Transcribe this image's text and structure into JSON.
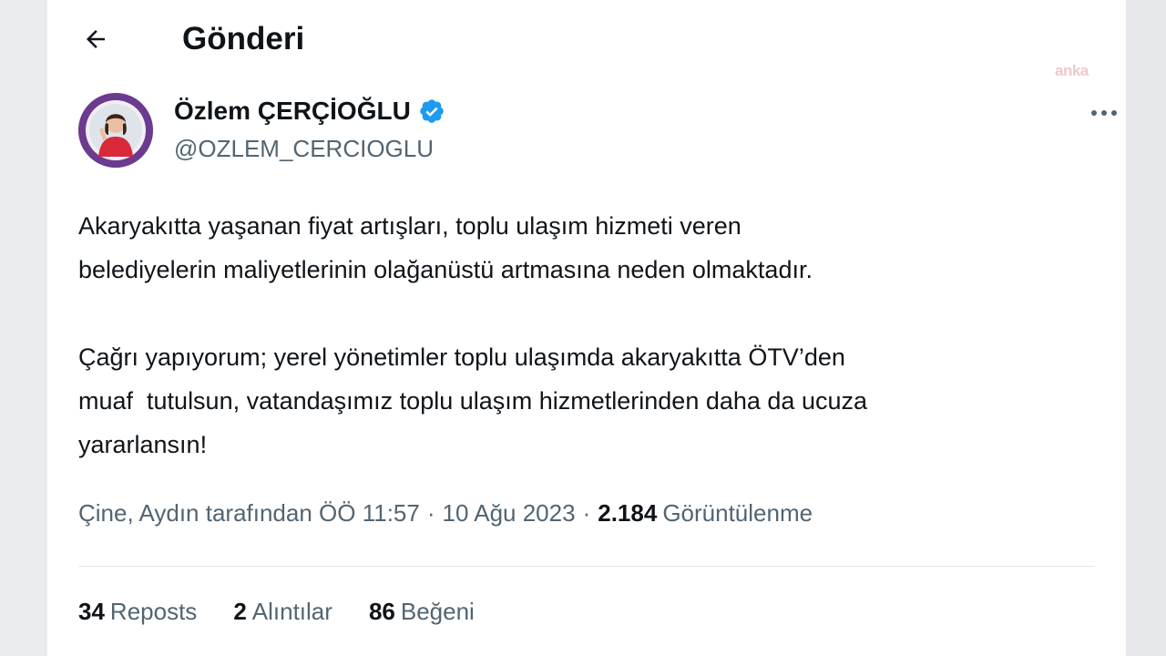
{
  "header": {
    "title": "Gönderi",
    "back_icon": "arrow-left-icon"
  },
  "watermark": "anka",
  "author": {
    "name": "Özlem ÇERÇİOĞLU",
    "handle": "@OZLEM_CERCIOGLU",
    "verified_icon": "verified-badge-icon",
    "verified_color": "#1d9bf0"
  },
  "more_icon": "more-horizontal-icon",
  "tweet": {
    "paragraph_1": "Akaryakıtta yaşanan fiyat artışları, toplu ulaşım hizmeti veren\nbelediyelerin maliyetlerinin olağanüstü artmasına neden olmaktadır.",
    "paragraph_2": "Çağrı yapıyorum; yerel yönetimler toplu ulaşımda akaryakıtta ÖTV’den\nmuaf  tutulsun, vatandaşımız toplu ulaşım hizmetlerinden daha da ucuza\nyararlansın!"
  },
  "meta": {
    "location_time": "Çine, Aydın tarafından ÖÖ 11:57",
    "separator": "·",
    "date": "10 Ağu 2023",
    "views_count": "2.184",
    "views_label": "Görüntülenme"
  },
  "stats": {
    "reposts_count": "34",
    "reposts_label": "Reposts",
    "quotes_count": "2",
    "quotes_label": "Alıntılar",
    "likes_count": "86",
    "likes_label": "Beğeni"
  },
  "colors": {
    "text_primary": "#0f1419",
    "text_secondary": "#536471",
    "avatar_ring": "#6b3b8f"
  }
}
